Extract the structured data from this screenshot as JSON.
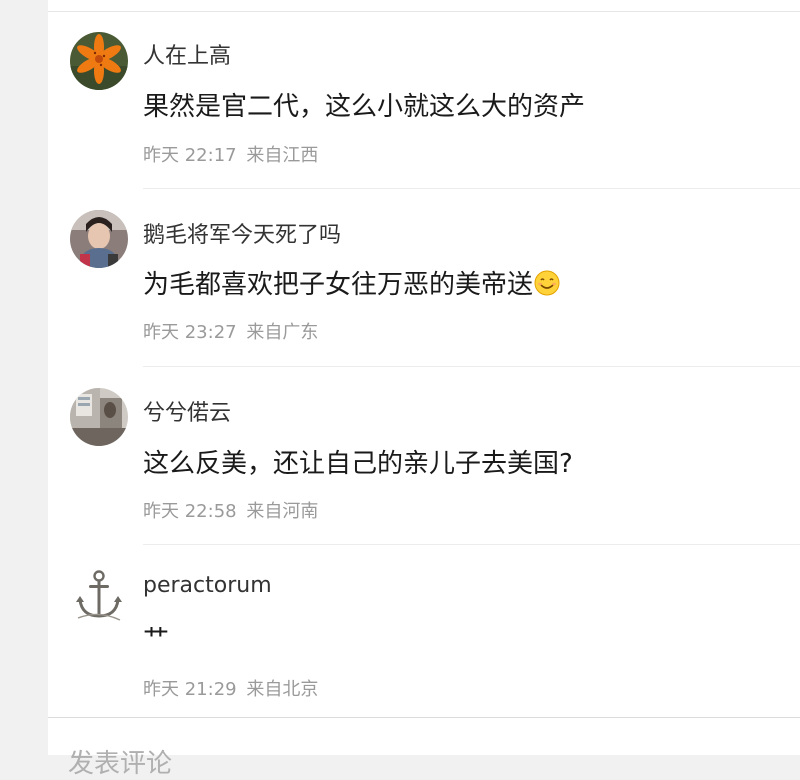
{
  "comments": [
    {
      "username": "人在上高",
      "text": "果然是官二代，这么小就这么大的资产",
      "time": "昨天 22:17",
      "location": "来自江西",
      "avatar_icon": "orange-lily-avatar"
    },
    {
      "username": "鹅毛将军今天死了吗",
      "text": "为毛都喜欢把子女往万恶的美帝送",
      "emoji": "smile-emoji",
      "time": "昨天 23:27",
      "location": "来自广东",
      "avatar_icon": "person-photo-avatar"
    },
    {
      "username": "兮兮偌云",
      "text": "这么反美，还让自己的亲儿子去美国?",
      "time": "昨天 22:58",
      "location": "来自河南",
      "avatar_icon": "room-photo-avatar"
    },
    {
      "username": "peractorum",
      "text": "艹",
      "time": "昨天 21:29",
      "location": "来自北京",
      "avatar_icon": "anchor-avatar"
    }
  ],
  "footer": {
    "post_comment_label": "发表评论"
  },
  "colors": {
    "text_primary": "#1a1a1a",
    "text_meta": "#9a9a9a",
    "divider": "#ececec",
    "sidebar_bg": "#f1f1f1"
  }
}
